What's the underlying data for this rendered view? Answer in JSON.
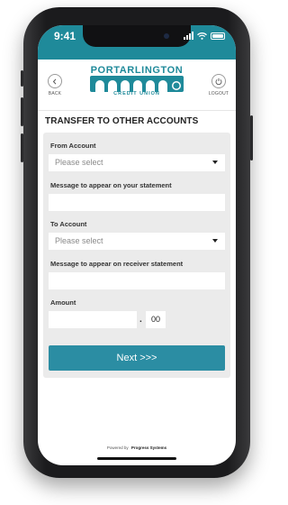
{
  "status_bar": {
    "time": "9:41",
    "signal_icon": "signal-bars-icon",
    "wifi_icon": "wifi-icon",
    "battery_icon": "battery-icon",
    "background_color": "#1f8a9a"
  },
  "header": {
    "back_label": "BACK",
    "back_icon": "chevron-left-icon",
    "logout_label": "LOGOUT",
    "logout_icon": "power-icon",
    "logo_name": "PORTARLINGTON",
    "logo_subtitle": "CREDIT UNION",
    "brand_color": "#1f8a9a"
  },
  "page": {
    "title": "TRANSFER TO OTHER ACCOUNTS"
  },
  "form": {
    "from_account": {
      "label": "From Account",
      "selected": "Please select"
    },
    "statement_message": {
      "label": "Message to appear on your statement",
      "value": ""
    },
    "to_account": {
      "label": "To Account",
      "selected": "Please select"
    },
    "receiver_message": {
      "label": "Message to appear on receiver statement",
      "value": ""
    },
    "amount": {
      "label": "Amount",
      "whole": "",
      "separator": ".",
      "cents": "00"
    },
    "next_button": {
      "label": "Next >>>",
      "color": "#2b8da3"
    }
  },
  "footer": {
    "powered_by": "Powered by",
    "company": "Progress Systems"
  }
}
